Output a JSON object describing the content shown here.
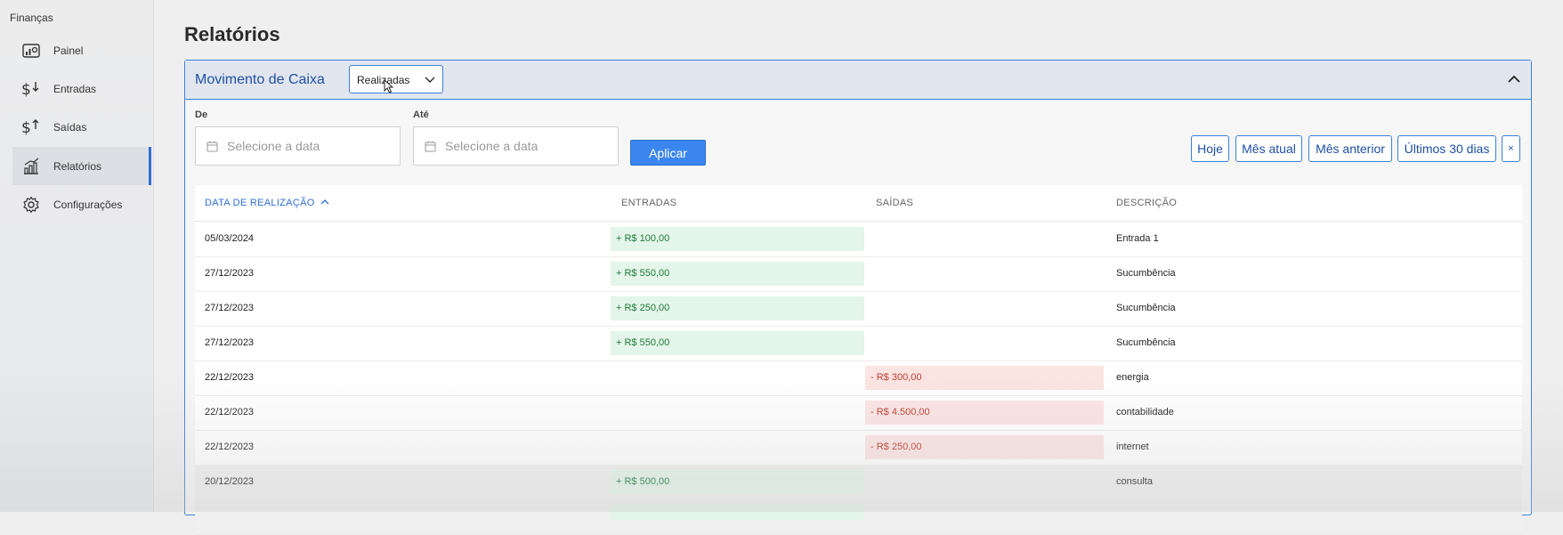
{
  "sidebar": {
    "brand": "Finanças",
    "items": [
      {
        "label": "Painel",
        "icon": "dashboard-chart-icon"
      },
      {
        "label": "Entradas",
        "icon": "dollar-arrow-down-icon"
      },
      {
        "label": "Saídas",
        "icon": "dollar-arrow-up-icon"
      },
      {
        "label": "Relatórios",
        "icon": "report-chart-icon",
        "active": true
      },
      {
        "label": "Configurações",
        "icon": "gear-icon"
      }
    ]
  },
  "page": {
    "title": "Relatórios"
  },
  "panel": {
    "title": "Movimento de Caixa",
    "select_value": "Realizadas",
    "from_label": "De",
    "to_label": "Até",
    "date_placeholder": "Selecione a data",
    "apply_label": "Aplicar",
    "quick": [
      "Hoje",
      "Mês atual",
      "Mês anterior",
      "Últimos 30 dias",
      "×"
    ]
  },
  "table": {
    "headers": {
      "date": "DATA DE REALIZAÇÃO",
      "income": "ENTRADAS",
      "expense": "SAÍDAS",
      "description": "DESCRIÇÃO"
    },
    "rows": [
      {
        "date": "05/03/2024",
        "income": "+ R$ 100,00",
        "expense": "",
        "description": "Entrada 1"
      },
      {
        "date": "27/12/2023",
        "income": "+ R$ 550,00",
        "expense": "",
        "description": "Sucumbência"
      },
      {
        "date": "27/12/2023",
        "income": "+ R$ 250,00",
        "expense": "",
        "description": "Sucumbência"
      },
      {
        "date": "27/12/2023",
        "income": "+ R$ 550,00",
        "expense": "",
        "description": "Sucumbência"
      },
      {
        "date": "22/12/2023",
        "income": "",
        "expense": "- R$ 300,00",
        "description": "energia"
      },
      {
        "date": "22/12/2023",
        "income": "",
        "expense": "- R$ 4.500,00",
        "description": "contabilidade"
      },
      {
        "date": "22/12/2023",
        "income": "",
        "expense": "- R$ 250,00",
        "description": "internet"
      },
      {
        "date": "20/12/2023",
        "income": "+ R$ 500,00",
        "expense": "",
        "description": "consulta"
      }
    ]
  },
  "colors": {
    "accent": "#2f6fd6",
    "income_text": "#1d7a3a",
    "income_bg": "#e4f5e9",
    "expense_text": "#c0392b",
    "expense_bg": "#fbe5e3"
  }
}
